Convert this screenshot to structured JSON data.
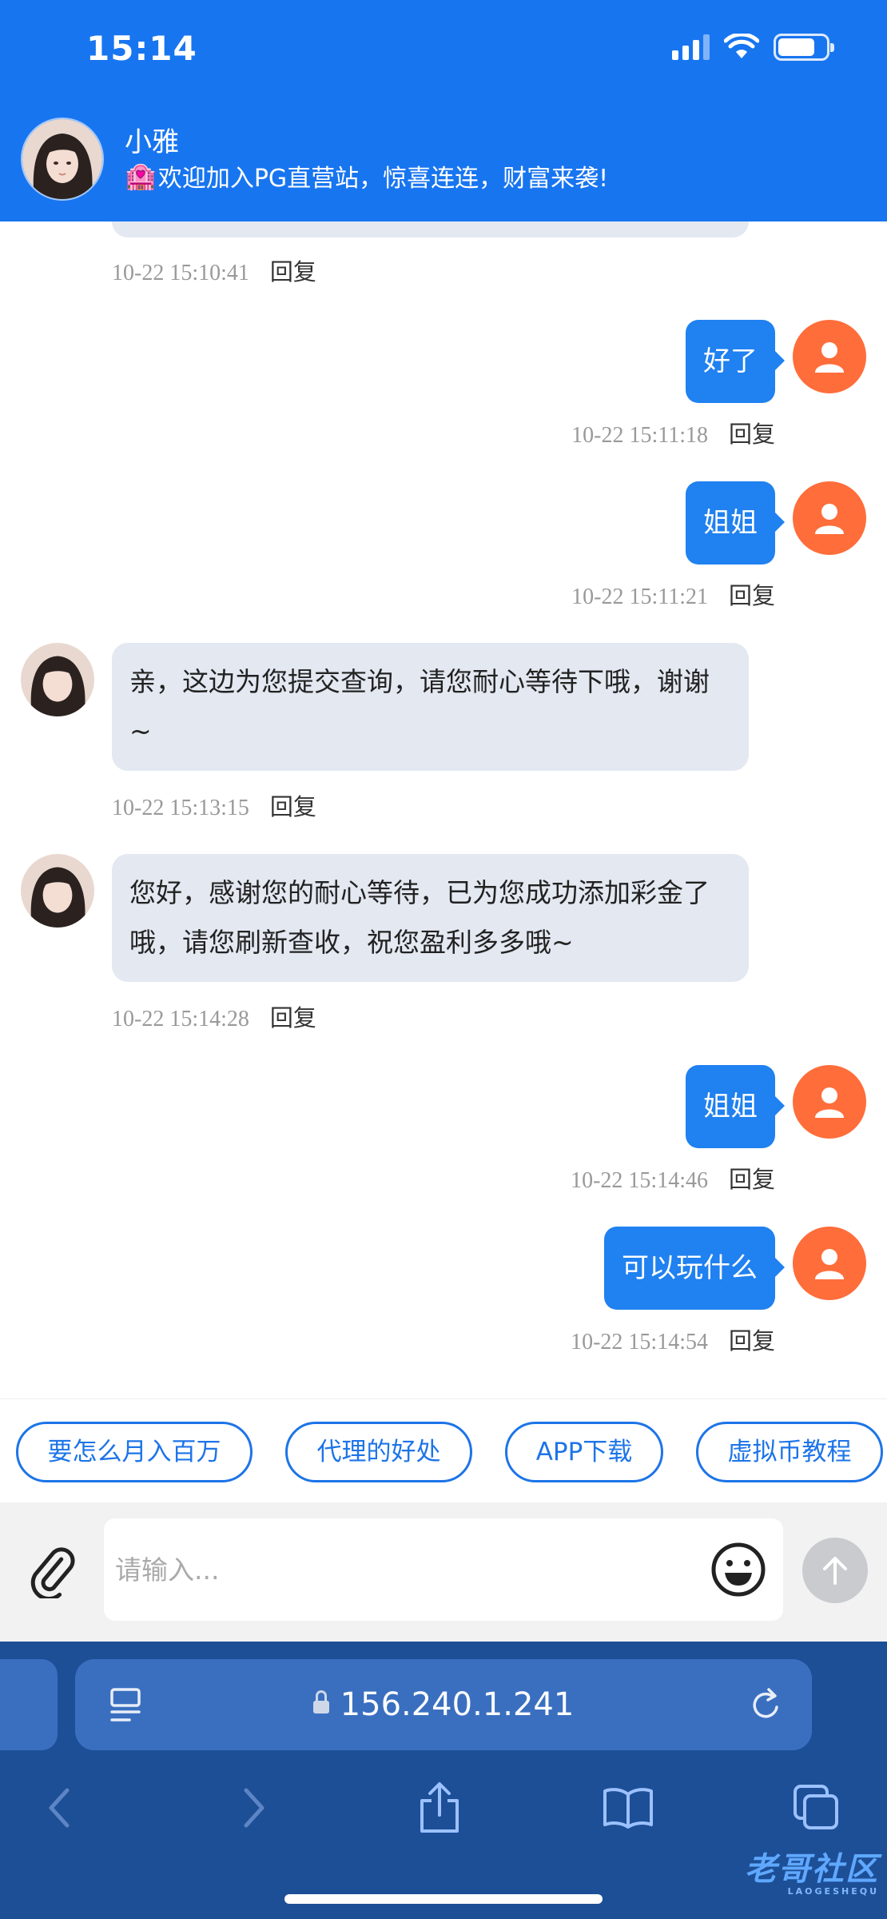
{
  "status_bar": {
    "time": "15:14"
  },
  "header": {
    "agent_name": "小雅",
    "greeting_emoji": "🏩",
    "greeting": "欢迎加入PG直营站，惊喜连连，财富来袭!"
  },
  "messages": [
    {
      "side": "left-partial",
      "time": "10-22 15:10:41",
      "reply_label": "回复"
    },
    {
      "side": "right",
      "text": "好了",
      "time": "10-22 15:11:18",
      "reply_label": "回复"
    },
    {
      "side": "right",
      "text": "姐姐",
      "time": "10-22 15:11:21",
      "reply_label": "回复"
    },
    {
      "side": "left",
      "text": "亲，这边为您提交查询，请您耐心等待下哦，谢谢~",
      "time": "10-22 15:13:15",
      "reply_label": "回复"
    },
    {
      "side": "left",
      "text": "您好，感谢您的耐心等待，已为您成功添加彩金了哦，请您刷新查收，祝您盈利多多哦~",
      "time": "10-22 15:14:28",
      "reply_label": "回复"
    },
    {
      "side": "right",
      "text": "姐姐",
      "time": "10-22 15:14:46",
      "reply_label": "回复"
    },
    {
      "side": "right",
      "text": "可以玩什么",
      "time": "10-22 15:14:54",
      "reply_label": "回复"
    }
  ],
  "quick_replies": [
    "要怎么月入百万",
    "代理的好处",
    "APP下载",
    "虚拟币教程"
  ],
  "input": {
    "placeholder": "请输入..."
  },
  "browser": {
    "url": "156.240.1.241"
  },
  "watermark": {
    "text": "老哥社区",
    "subtext": "LAOGESHEQU"
  },
  "colors": {
    "header": "#1875f0",
    "user_bubble": "#2081f0",
    "agent_bubble": "#e3e8f1",
    "user_avatar": "#ff6d3a",
    "browser_bar": "#1d4f97"
  }
}
